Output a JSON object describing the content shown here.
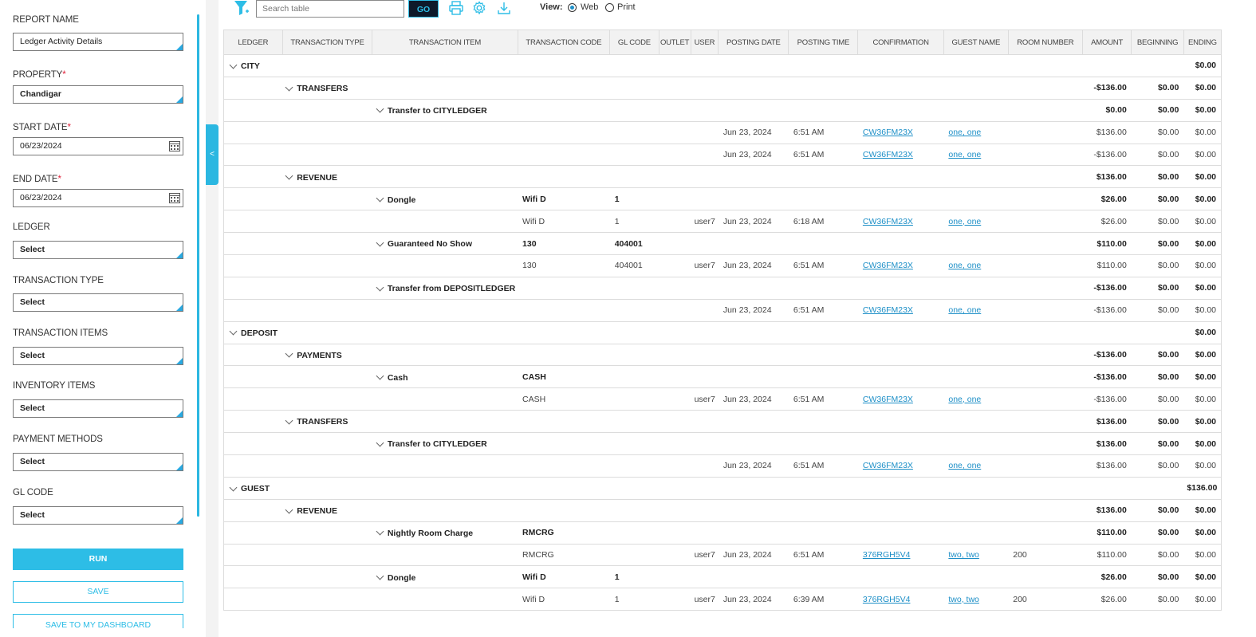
{
  "filters": {
    "report_name": {
      "label": "REPORT NAME",
      "value": "Ledger Activity Details"
    },
    "property": {
      "label": "PROPERTY",
      "required": "*",
      "value": "Chandigar"
    },
    "start_date": {
      "label": "START DATE",
      "required": "*",
      "value": "06/23/2024"
    },
    "end_date": {
      "label": "END DATE",
      "required": "*",
      "value": "06/23/2024"
    },
    "ledger": {
      "label": "LEDGER",
      "value": "Select"
    },
    "transaction_type": {
      "label": "TRANSACTION TYPE",
      "value": "Select"
    },
    "transaction_items": {
      "label": "TRANSACTION ITEMS",
      "value": "Select"
    },
    "inventory_items": {
      "label": "INVENTORY ITEMS",
      "value": "Select"
    },
    "payment_methods": {
      "label": "PAYMENT METHODS",
      "value": "Select"
    },
    "gl_code": {
      "label": "GL CODE",
      "value": "Select"
    }
  },
  "buttons": {
    "run": "RUN",
    "save": "SAVE",
    "save_dashboard": "SAVE TO MY DASHBOARD",
    "collapse": "<"
  },
  "toolbar": {
    "search_placeholder": "Search table",
    "go": "GO",
    "view_label": "View:",
    "view_web": "Web",
    "view_print": "Print",
    "selected_view": "Web"
  },
  "table": {
    "headers": [
      "LEDGER",
      "TRANSACTION TYPE",
      "TRANSACTION ITEM",
      "TRANSACTION CODE",
      "GL CODE",
      "OUTLET",
      "USER",
      "POSTING DATE",
      "POSTING TIME",
      "CONFIRMATION",
      "GUEST NAME",
      "ROOM NUMBER",
      "AMOUNT",
      "BEGINNING",
      "ENDING"
    ],
    "rows": [
      {
        "level": 0,
        "group": "CITY",
        "ending": "$0.00"
      },
      {
        "level": 1,
        "group": "TRANSFERS",
        "amount": "-$136.00",
        "beginning": "$0.00",
        "ending": "$0.00"
      },
      {
        "level": 2,
        "group": "Transfer to CITYLEDGER",
        "amount": "$0.00",
        "beginning": "$0.00",
        "ending": "$0.00"
      },
      {
        "level": 3,
        "date": "Jun 23, 2024",
        "time": "6:51 AM",
        "conf": "CW36FM23X",
        "guest": "one, one",
        "amount": "$136.00",
        "beginning": "$0.00",
        "ending": "$0.00"
      },
      {
        "level": 3,
        "date": "Jun 23, 2024",
        "time": "6:51 AM",
        "conf": "CW36FM23X",
        "guest": "one, one",
        "amount": "-$136.00",
        "beginning": "$0.00",
        "ending": "$0.00"
      },
      {
        "level": 1,
        "group": "REVENUE",
        "amount": "$136.00",
        "beginning": "$0.00",
        "ending": "$0.00"
      },
      {
        "level": 2,
        "group": "Dongle",
        "code": "Wifi D",
        "gl": "1",
        "amount": "$26.00",
        "beginning": "$0.00",
        "ending": "$0.00"
      },
      {
        "level": 3,
        "code": "Wifi D",
        "gl": "1",
        "user": "user7",
        "date": "Jun 23, 2024",
        "time": "6:18 AM",
        "conf": "CW36FM23X",
        "guest": "one, one",
        "amount": "$26.00",
        "beginning": "$0.00",
        "ending": "$0.00"
      },
      {
        "level": 2,
        "group": "Guaranteed No Show",
        "code": "130",
        "gl": "404001",
        "amount": "$110.00",
        "beginning": "$0.00",
        "ending": "$0.00"
      },
      {
        "level": 3,
        "code": "130",
        "gl": "404001",
        "user": "user7",
        "date": "Jun 23, 2024",
        "time": "6:51 AM",
        "conf": "CW36FM23X",
        "guest": "one, one",
        "amount": "$110.00",
        "beginning": "$0.00",
        "ending": "$0.00"
      },
      {
        "level": 2,
        "group": "Transfer from DEPOSITLEDGER",
        "amount": "-$136.00",
        "beginning": "$0.00",
        "ending": "$0.00"
      },
      {
        "level": 3,
        "date": "Jun 23, 2024",
        "time": "6:51 AM",
        "conf": "CW36FM23X",
        "guest": "one, one",
        "amount": "-$136.00",
        "beginning": "$0.00",
        "ending": "$0.00"
      },
      {
        "level": 0,
        "group": "DEPOSIT",
        "ending": "$0.00"
      },
      {
        "level": 1,
        "group": "PAYMENTS",
        "amount": "-$136.00",
        "beginning": "$0.00",
        "ending": "$0.00"
      },
      {
        "level": 2,
        "group": "Cash",
        "code": "CASH",
        "amount": "-$136.00",
        "beginning": "$0.00",
        "ending": "$0.00"
      },
      {
        "level": 3,
        "code": "CASH",
        "user": "user7",
        "date": "Jun 23, 2024",
        "time": "6:51 AM",
        "conf": "CW36FM23X",
        "guest": "one, one",
        "amount": "-$136.00",
        "beginning": "$0.00",
        "ending": "$0.00"
      },
      {
        "level": 1,
        "group": "TRANSFERS",
        "amount": "$136.00",
        "beginning": "$0.00",
        "ending": "$0.00"
      },
      {
        "level": 2,
        "group": "Transfer to CITYLEDGER",
        "amount": "$136.00",
        "beginning": "$0.00",
        "ending": "$0.00"
      },
      {
        "level": 3,
        "date": "Jun 23, 2024",
        "time": "6:51 AM",
        "conf": "CW36FM23X",
        "guest": "one, one",
        "amount": "$136.00",
        "beginning": "$0.00",
        "ending": "$0.00"
      },
      {
        "level": 0,
        "group": "GUEST",
        "ending": "$136.00"
      },
      {
        "level": 1,
        "group": "REVENUE",
        "amount": "$136.00",
        "beginning": "$0.00",
        "ending": "$0.00"
      },
      {
        "level": 2,
        "group": "Nightly Room Charge",
        "code": "RMCRG",
        "amount": "$110.00",
        "beginning": "$0.00",
        "ending": "$0.00"
      },
      {
        "level": 3,
        "code": "RMCRG",
        "user": "user7",
        "date": "Jun 23, 2024",
        "time": "6:51 AM",
        "conf": "376RGH5V4",
        "guest": "two, two",
        "room": "200",
        "amount": "$110.00",
        "beginning": "$0.00",
        "ending": "$0.00"
      },
      {
        "level": 2,
        "group": "Dongle",
        "code": "Wifi D",
        "gl": "1",
        "amount": "$26.00",
        "beginning": "$0.00",
        "ending": "$0.00"
      },
      {
        "level": 3,
        "code": "Wifi D",
        "gl": "1",
        "user": "user7",
        "date": "Jun 23, 2024",
        "time": "6:39 AM",
        "conf": "376RGH5V4",
        "guest": "two, two",
        "room": "200",
        "amount": "$26.00",
        "beginning": "$0.00",
        "ending": "$0.00"
      }
    ]
  },
  "colors": {
    "accent": "#2dbde6",
    "link": "#1d8fc7",
    "go_bg": "#0e1a2b",
    "required": "#e0213a"
  }
}
